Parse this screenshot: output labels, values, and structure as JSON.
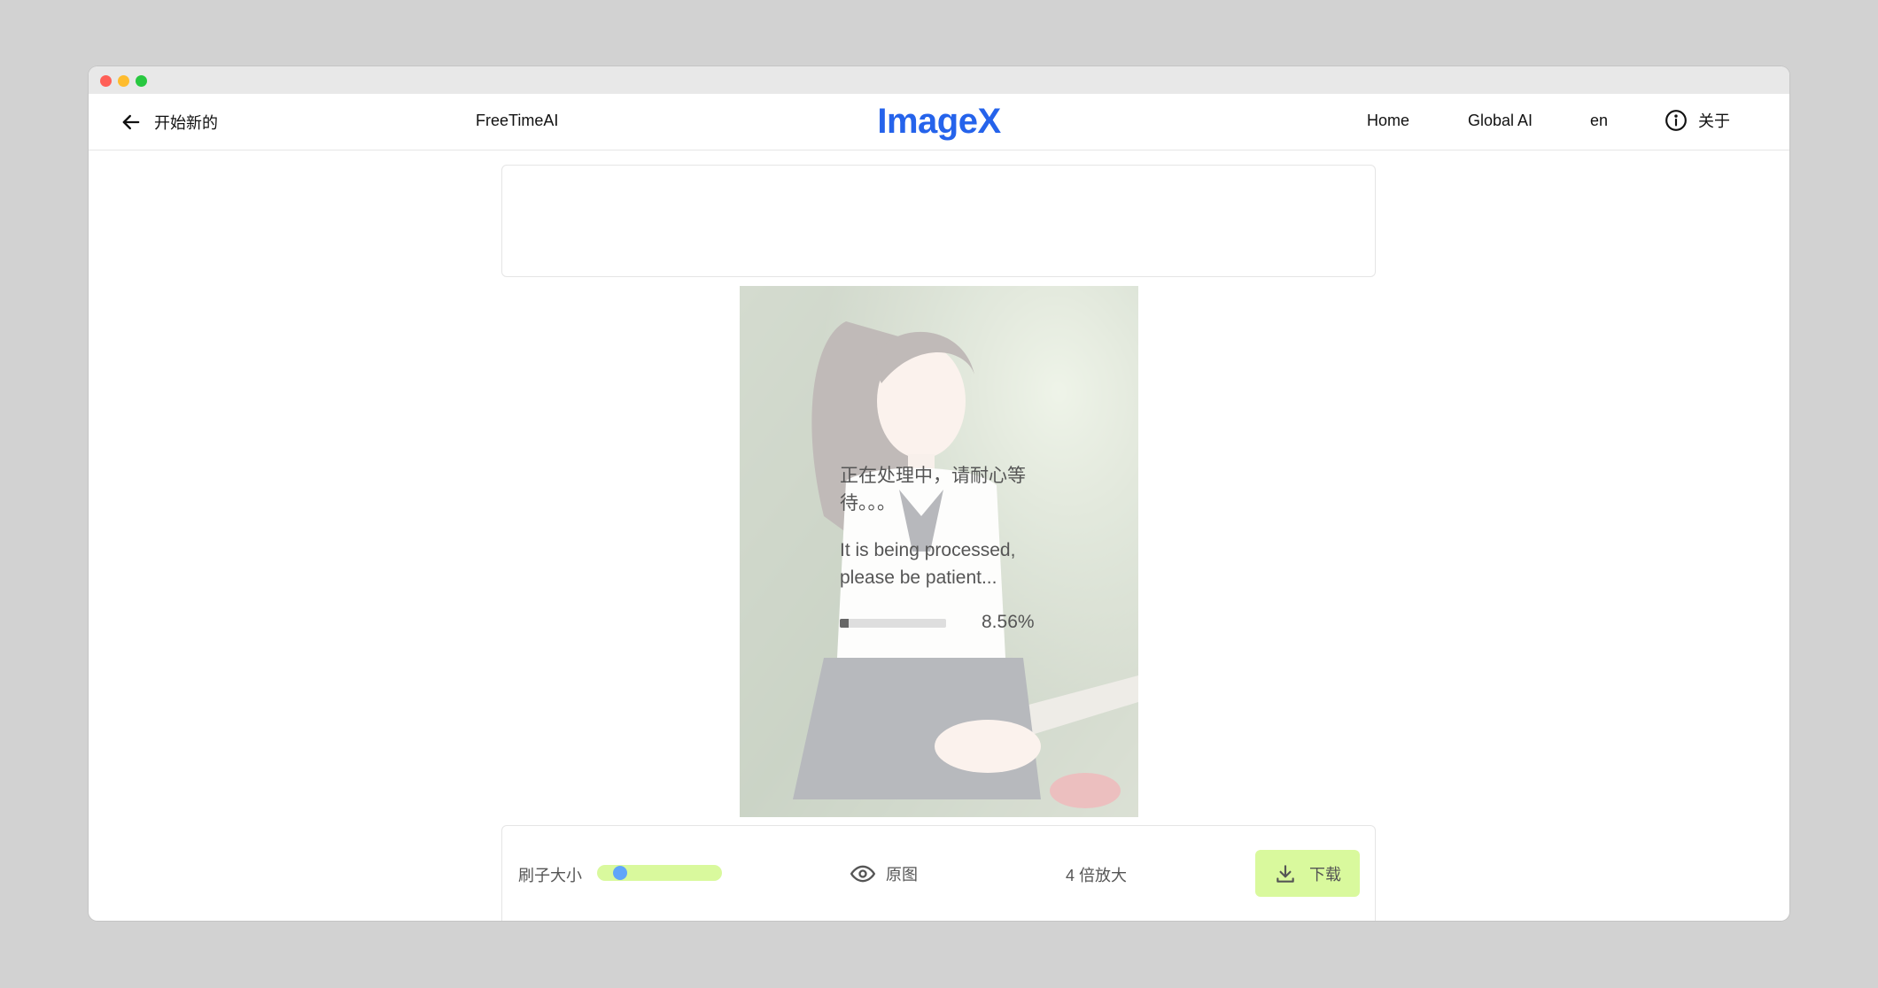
{
  "navbar": {
    "back_label": "开始新的",
    "brand_left": "FreeTimeAI",
    "logo": "ImageX",
    "links": [
      "Home",
      "Global AI",
      "en"
    ],
    "about_label": "关于"
  },
  "processing": {
    "message_zh": "正在处理中，请耐心等待。。。",
    "message_en": "It is being processed, please be patient...",
    "progress_percent": 8.56,
    "progress_label": "8.56%"
  },
  "toolbar": {
    "brush_label": "刷子大小",
    "brush_size_fraction": 0.13,
    "original_label": "原图",
    "upscale_label": "4 倍放大",
    "download_label": "下载"
  },
  "colors": {
    "accent": "#2563eb",
    "button_bg": "#d9f99d",
    "slider_thumb": "#60a5fa"
  },
  "icons": {
    "back": "arrow-left-icon",
    "about": "info-circle-icon",
    "original": "eye-icon",
    "download": "download-icon"
  }
}
